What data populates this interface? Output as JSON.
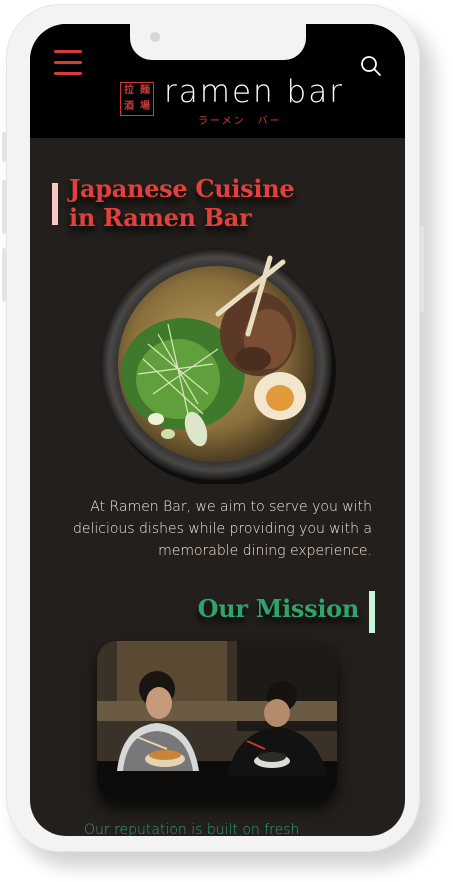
{
  "header": {
    "menu_icon": "hamburger-icon",
    "search_icon": "search-icon",
    "logo_stamp": [
      "拉",
      "麺",
      "酒",
      "場"
    ],
    "logo_word": "ramen bar",
    "logo_kana": "ラーメン　バー"
  },
  "hero": {
    "title_line1": "Japanese Cuisine",
    "title_line2": "in Ramen Bar",
    "image": "ramen-bowl-photo",
    "intro": "At Ramen Bar, we aim to serve you with delicious dishes while providing you with a memorable dining experience."
  },
  "mission": {
    "title": "Our Mission",
    "image": "diners-eating-ramen-photo",
    "text": "Our reputation is built on fresh"
  },
  "colors": {
    "background": "#231f1c",
    "header": "#000000",
    "accent_red": "#e0413c",
    "accent_green": "#2fa36b",
    "text": "#f3e2d6"
  }
}
